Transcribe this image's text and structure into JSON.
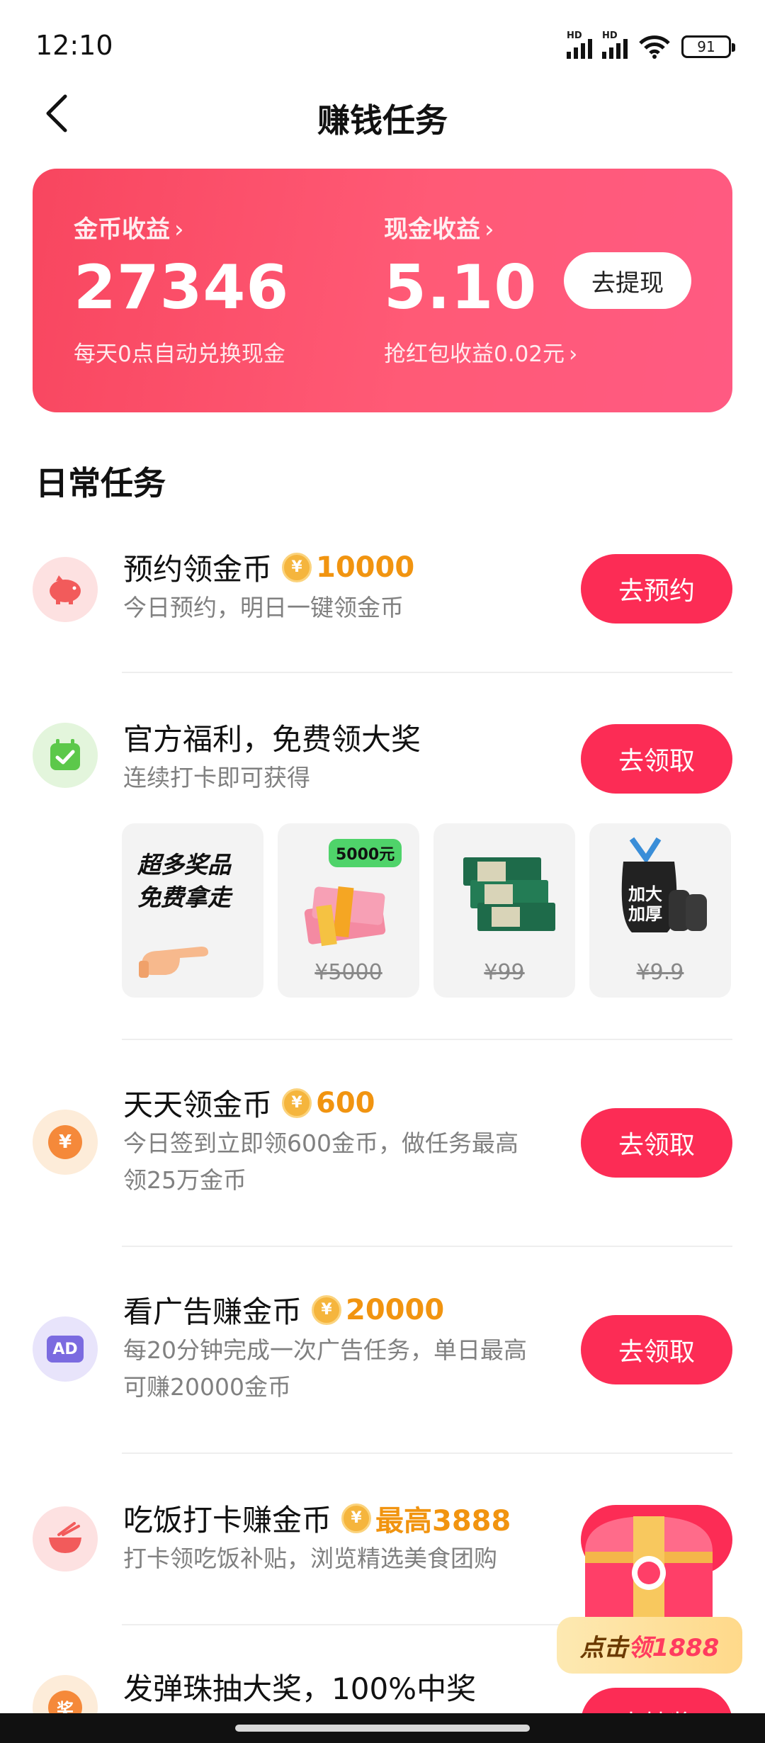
{
  "status_bar": {
    "time": "12:10",
    "battery": "91",
    "hd": "HD"
  },
  "header": {
    "title": "赚钱任务"
  },
  "earnings": {
    "coin_label": "金币收益",
    "coin_value": "27346",
    "coin_sub": "每天0点自动兑换现金",
    "cash_label": "现金收益",
    "cash_value": "5.10",
    "cash_sub": "抢红包收益0.02元",
    "withdraw_button": "去提现"
  },
  "section": {
    "title": "日常任务"
  },
  "tasks": [
    {
      "title": "预约领金币",
      "reward": "10000",
      "desc": "今日预约，明日一键领金币",
      "button": "去预约",
      "icon": "piggy-bank-icon"
    },
    {
      "title": "官方福利，免费领大奖",
      "desc": "连续打卡即可获得",
      "button": "去领取",
      "icon": "calendar-check-icon"
    },
    {
      "title": "天天领金币",
      "reward": "600",
      "desc": "今日签到立即领600金币，做任务最高领25万金币",
      "button": "去领取",
      "icon": "yuan-coin-icon"
    },
    {
      "title": "看广告赚金币",
      "reward": "20000",
      "desc": "每20分钟完成一次广告任务，单日最高可赚20000金币",
      "button": "去领取",
      "icon": "ad-icon"
    },
    {
      "title": "吃饭打卡赚金币",
      "reward": "最高3888",
      "desc": "打卡领吃饭补贴，浏览精选美食团购",
      "button": "去领取",
      "icon": "rice-bowl-icon"
    },
    {
      "title": "发弹珠抽大奖，100%中奖",
      "button": "去抽奖",
      "icon": "prize-icon"
    }
  ],
  "prizes": {
    "promo_line1": "超多奖品",
    "promo_line2": "免费拿走",
    "items": [
      {
        "price": "¥5000",
        "tag": "5000元"
      },
      {
        "price": "¥99"
      },
      {
        "price": "¥9.9",
        "tag": "加大加厚"
      }
    ]
  },
  "coin_symbol": "¥",
  "ad_label": "AD",
  "prize_char": "奖",
  "floating": {
    "label_prefix": "点击",
    "label_accent": "领1888"
  },
  "colors": {
    "primary": "#fc2c55",
    "reward": "#f19410",
    "card_gradient_start": "#f8465f",
    "card_gradient_end": "#ff5a82"
  }
}
